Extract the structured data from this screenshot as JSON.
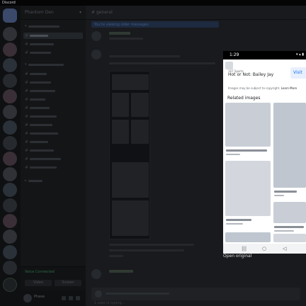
{
  "window": {
    "title": "Discord"
  },
  "server": {
    "name": "Phantom Den"
  },
  "channel_header": {
    "name": "general"
  },
  "banner": {
    "text": "You're viewing older messages"
  },
  "voice": {
    "status": "Voice Connected",
    "video_label": "Video",
    "screen_label": "Screen"
  },
  "user_panel": {
    "name": "Phase"
  },
  "typing": {
    "text": "1 user is typing..."
  },
  "phone": {
    "time": "1:29",
    "status_icons": "▾ ▴ ▮",
    "source_meta": "167 Sports",
    "source_title": "Hot or Not: Bailey Jay",
    "visit_label": "Visit",
    "copyright_text": "Images may be subject to copyright.",
    "learn_more_label": "Learn More",
    "related_title": "Related images",
    "nav_icons": {
      "back": "◁",
      "home": "○",
      "recents": "|||"
    }
  },
  "lightbox": {
    "open_original_label": "Open original"
  },
  "icons": [
    "hash-icon",
    "chevron-down-icon",
    "plus-icon",
    "mic-icon",
    "headphones-icon",
    "settings-icon",
    "back-icon",
    "home-icon",
    "recents-icon"
  ]
}
